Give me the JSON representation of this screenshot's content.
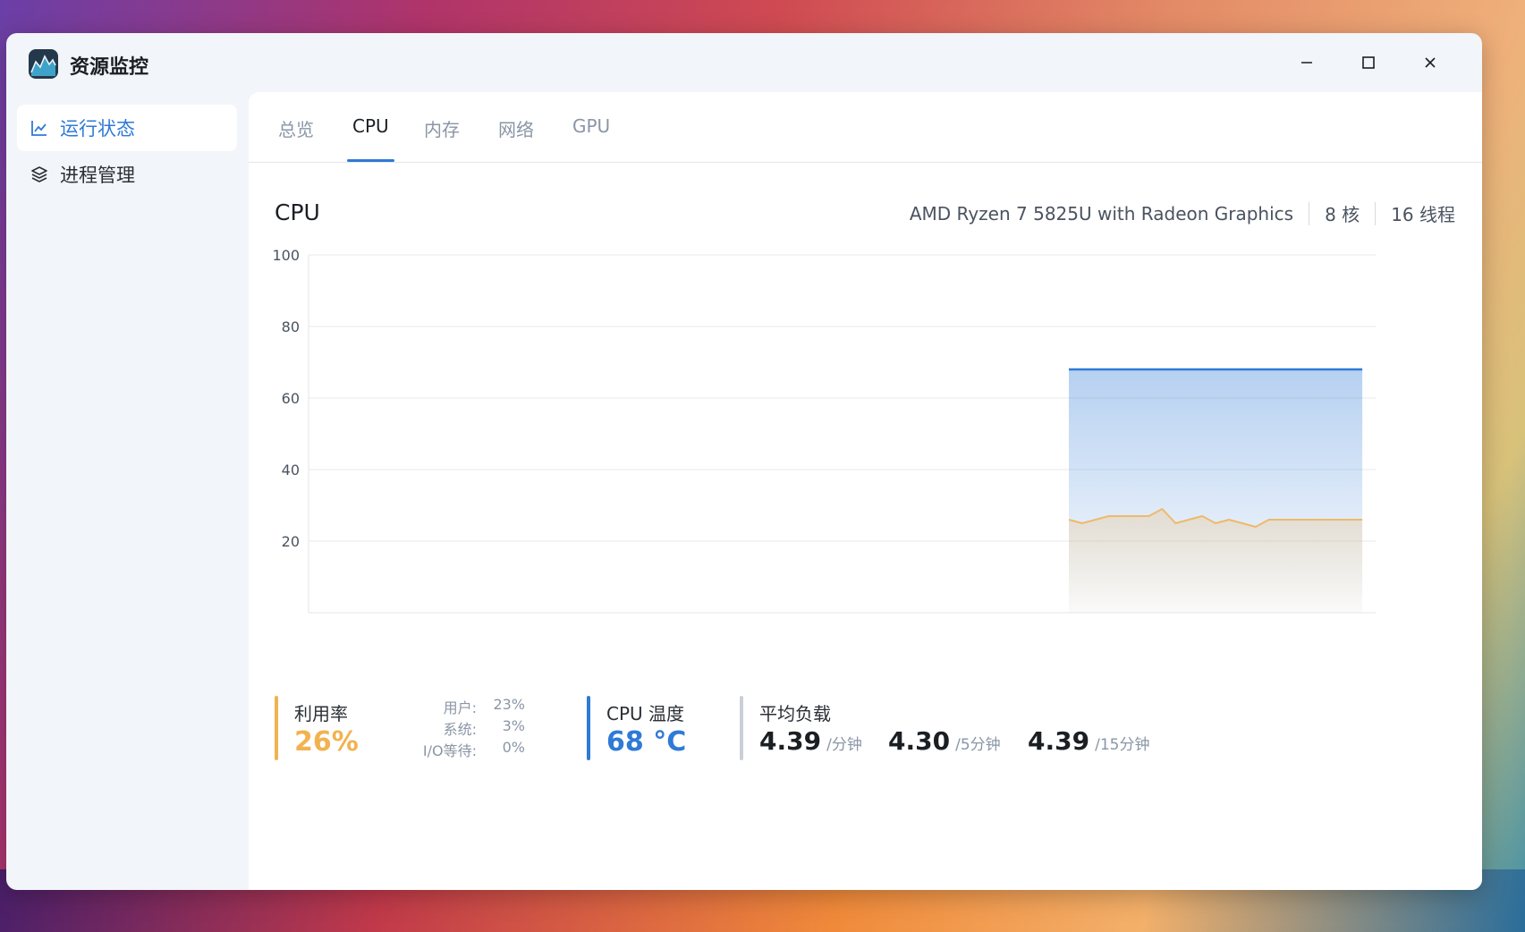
{
  "window": {
    "title": "资源监控",
    "controls": {
      "minimize": "minimize-icon",
      "maximize": "maximize-icon",
      "close": "close-icon"
    }
  },
  "sidebar": {
    "items": [
      {
        "label": "运行状态",
        "icon": "line-chart-icon",
        "active": true
      },
      {
        "label": "进程管理",
        "icon": "layers-icon",
        "active": false
      }
    ]
  },
  "tabs": [
    {
      "label": "总览",
      "active": false
    },
    {
      "label": "CPU",
      "active": true
    },
    {
      "label": "内存",
      "active": false
    },
    {
      "label": "网络",
      "active": false
    },
    {
      "label": "GPU",
      "active": false
    }
  ],
  "cpu": {
    "title": "CPU",
    "model": "AMD Ryzen 7 5825U with Radeon Graphics",
    "cores": "8 核",
    "threads": "16 线程"
  },
  "chart_data": {
    "type": "area",
    "title": "",
    "xlabel": "",
    "ylabel": "",
    "ylim": [
      0,
      100
    ],
    "yticks": [
      20,
      40,
      60,
      80,
      100
    ],
    "grid": true,
    "x": [
      0,
      1,
      2,
      3,
      4,
      5,
      6,
      7,
      8,
      9,
      10,
      11,
      12,
      13,
      14,
      15,
      16,
      17,
      18,
      19,
      20,
      21,
      22,
      23,
      24,
      25,
      26,
      27,
      28,
      29,
      30,
      31,
      32,
      33,
      34,
      35,
      36,
      37,
      38,
      39,
      40,
      41,
      42,
      43,
      44,
      45,
      46,
      47,
      48,
      49,
      50,
      51,
      52,
      53,
      54,
      55,
      56,
      57,
      58,
      59,
      60,
      61,
      62,
      63,
      64,
      65,
      66,
      67,
      68,
      69,
      70,
      71,
      72,
      73,
      74,
      75,
      76,
      77,
      78,
      79,
      80
    ],
    "series": [
      {
        "values": [
          null,
          null,
          null,
          null,
          null,
          null,
          null,
          null,
          null,
          null,
          null,
          null,
          null,
          null,
          null,
          null,
          null,
          null,
          null,
          null,
          null,
          null,
          null,
          null,
          null,
          null,
          null,
          null,
          null,
          null,
          null,
          null,
          null,
          null,
          null,
          null,
          null,
          null,
          null,
          null,
          null,
          null,
          null,
          null,
          null,
          null,
          null,
          null,
          null,
          null,
          null,
          null,
          null,
          null,
          null,
          null,
          null,
          68,
          68,
          68,
          68,
          68,
          68,
          68,
          68,
          68,
          68,
          68,
          68,
          68,
          68,
          68,
          68,
          68,
          68,
          68,
          68,
          68,
          68,
          68
        ],
        "color": "#2e7ad6"
      },
      {
        "values": [
          null,
          null,
          null,
          null,
          null,
          null,
          null,
          null,
          null,
          null,
          null,
          null,
          null,
          null,
          null,
          null,
          null,
          null,
          null,
          null,
          null,
          null,
          null,
          null,
          null,
          null,
          null,
          null,
          null,
          null,
          null,
          null,
          null,
          null,
          null,
          null,
          null,
          null,
          null,
          null,
          null,
          null,
          null,
          null,
          null,
          null,
          null,
          null,
          null,
          null,
          null,
          null,
          null,
          null,
          null,
          null,
          null,
          26,
          25,
          26,
          27,
          27,
          27,
          27,
          29,
          25,
          26,
          27,
          25,
          26,
          25,
          24,
          26,
          26,
          26,
          26,
          26,
          26,
          26,
          26
        ],
        "color": "#efb96a"
      }
    ]
  },
  "stats": {
    "utilization": {
      "label": "利用率",
      "value": "26%",
      "color": "#f2b24f"
    },
    "breakdown": [
      {
        "key": "用户:",
        "value": "23%"
      },
      {
        "key": "系统:",
        "value": "3%"
      },
      {
        "key": "I/O等待:",
        "value": "0%"
      }
    ],
    "temperature": {
      "label": "CPU 温度",
      "value": "68 °C",
      "color": "#2e7ad6"
    },
    "load": {
      "label": "平均负载",
      "color": "#c9cfd8",
      "items": [
        {
          "value": "4.39",
          "unit": "/分钟"
        },
        {
          "value": "4.30",
          "unit": "/5分钟"
        },
        {
          "value": "4.39",
          "unit": "/15分钟"
        }
      ]
    }
  }
}
